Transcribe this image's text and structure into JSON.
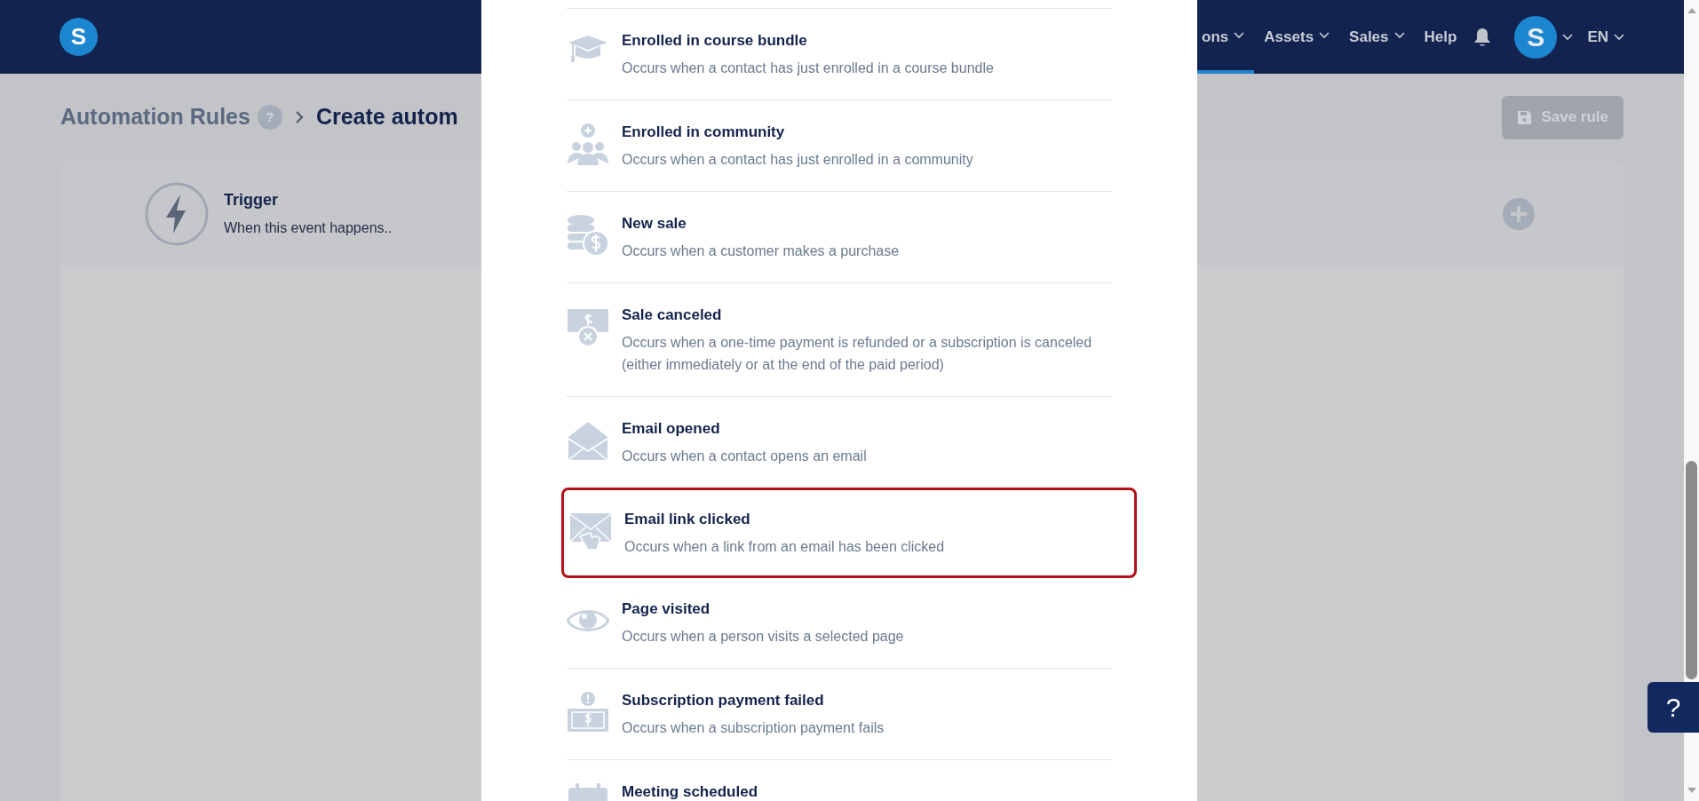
{
  "nav": {
    "logo": "S",
    "items": [
      {
        "label": "ons",
        "dropdown": true,
        "selected": true
      },
      {
        "label": "Assets",
        "dropdown": true,
        "selected": false
      },
      {
        "label": "Sales",
        "dropdown": true,
        "selected": false
      },
      {
        "label": "Help",
        "dropdown": false,
        "selected": false
      }
    ],
    "avatar": "S",
    "language": "EN"
  },
  "breadcrumb": {
    "parent": "Automation Rules",
    "help": "?",
    "current": "Create autom"
  },
  "save_button": {
    "label": "Save rule",
    "disabled": true
  },
  "trigger": {
    "title": "Trigger",
    "subtitle": "When this event happens.."
  },
  "modal": {
    "events": [
      {
        "kind": "course",
        "title": "Enrolled in course bundle",
        "description": "Occurs when a contact has just enrolled in a course bundle",
        "highlighted": false
      },
      {
        "kind": "community",
        "title": "Enrolled in community",
        "description": "Occurs when a contact has just enrolled in a community",
        "highlighted": false
      },
      {
        "kind": "sale",
        "title": "New sale",
        "description": "Occurs when a customer makes a purchase",
        "highlighted": false
      },
      {
        "kind": "cancel",
        "title": "Sale canceled",
        "description": "Occurs when a one-time payment is refunded or a subscription is canceled (either immediately or at the end of the paid period)",
        "highlighted": false
      },
      {
        "kind": "email",
        "title": "Email opened",
        "description": "Occurs when a contact opens an email",
        "highlighted": false
      },
      {
        "kind": "click",
        "title": "Email link clicked",
        "description": "Occurs when a link from an email has been clicked",
        "highlighted": true
      },
      {
        "kind": "page",
        "title": "Page visited",
        "description": "Occurs when a person visits a selected page",
        "highlighted": false
      },
      {
        "kind": "failed",
        "title": "Subscription payment failed",
        "description": "Occurs when a subscription payment fails",
        "highlighted": false
      },
      {
        "kind": "meeting",
        "title": "Meeting scheduled",
        "highlighted": false
      }
    ]
  },
  "help_widget": {
    "label": "?"
  }
}
